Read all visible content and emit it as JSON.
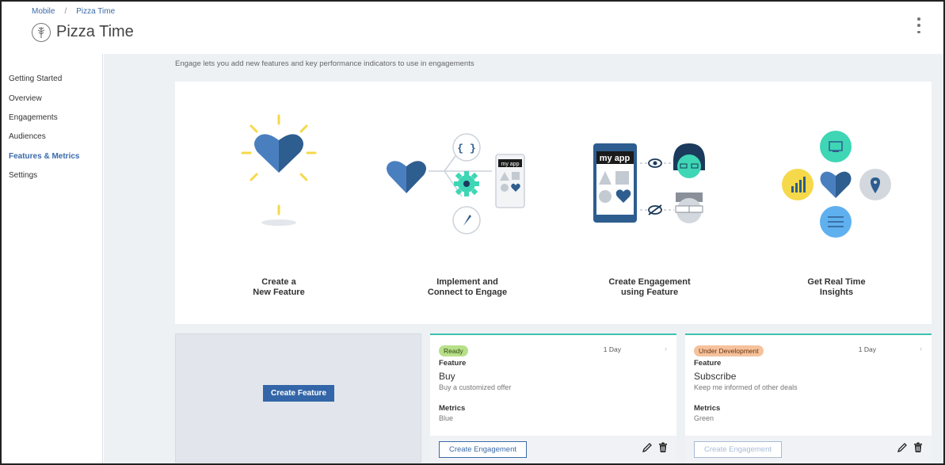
{
  "breadcrumb": {
    "root": "Mobile",
    "separator": "/",
    "current": "Pizza Time"
  },
  "app": {
    "title": "Pizza Time"
  },
  "sidebar": {
    "items": [
      {
        "label": "Getting Started"
      },
      {
        "label": "Overview"
      },
      {
        "label": "Engagements"
      },
      {
        "label": "Audiences"
      },
      {
        "label": "Features & Metrics",
        "active": true
      },
      {
        "label": "Settings"
      }
    ]
  },
  "main": {
    "intro": "Engage lets you add new features and key performance indicators to use in engagements",
    "steps": [
      {
        "line1": "Create a",
        "line2": "New Feature"
      },
      {
        "line1": "Implement and",
        "line2": "Connect to Engage"
      },
      {
        "line1": "Create Engagement",
        "line2": "using Feature"
      },
      {
        "line1": "Get Real Time",
        "line2": "Insights"
      }
    ],
    "illustration_text": {
      "my_app_small": "my app",
      "my_app_large": "my app"
    },
    "create_feature_label": "Create Feature",
    "cards": [
      {
        "status": "Ready",
        "age": "1 Day",
        "feature_label": "Feature",
        "name": "Buy",
        "description": "Buy a customized offer",
        "metrics_label": "Metrics",
        "metric": "Blue",
        "action_label": "Create Engagement"
      },
      {
        "status": "Under Development",
        "age": "1 Day",
        "feature_label": "Feature",
        "name": "Subscribe",
        "description": "Keep me informed of other deals",
        "metrics_label": "Metrics",
        "metric": "Green",
        "action_label": "Create Engagement"
      }
    ]
  },
  "colors": {
    "accent": "#3b6aa8",
    "button": "#3366a8",
    "card_top": "#3cc1b0",
    "ready_badge": "#b8e08a",
    "dev_badge": "#f5c29c",
    "heart_dark": "#2e5d8f",
    "heart_light": "#4a7fbf",
    "teal": "#3ed6b5",
    "yellow": "#f5d94a"
  }
}
